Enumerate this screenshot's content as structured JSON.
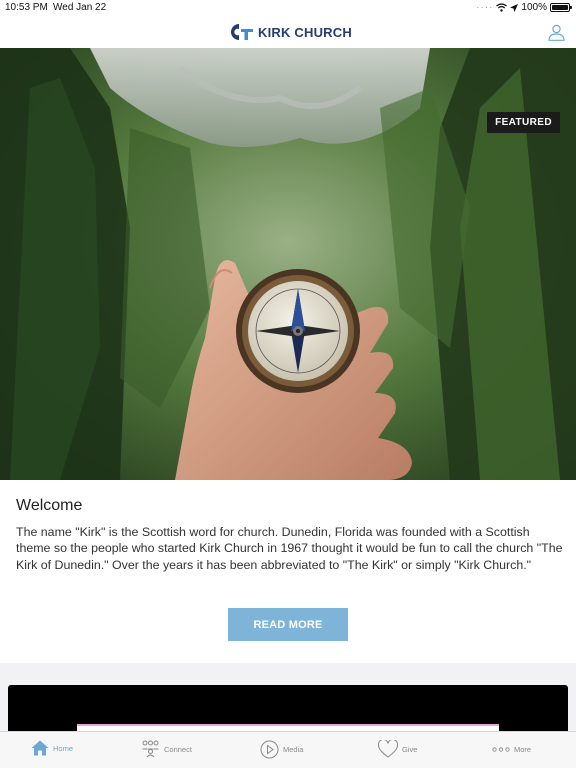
{
  "status_bar": {
    "time": "10:53 PM",
    "date": "Wed Jan 22",
    "battery": "100%"
  },
  "header": {
    "logo_text": "KIRK CHURCH"
  },
  "hero": {
    "badge": "FEATURED"
  },
  "article": {
    "title": "Welcome",
    "body": "The name \"Kirk\" is the Scottish word for church. Dunedin, Florida was founded with a Scottish theme so the people who started Kirk Church in 1967 thought it would be fun to call the church \"The Kirk of Dunedin.\" Over the years it has been abbreviated to \"The Kirk\" or simply \"Kirk Church.\"",
    "button_label": "READ MORE"
  },
  "tabs": [
    {
      "label": "Home",
      "icon": "home-icon"
    },
    {
      "label": "Connect",
      "icon": "people-icon"
    },
    {
      "label": "Media",
      "icon": "play-icon"
    },
    {
      "label": "Give",
      "icon": "heart-icon"
    },
    {
      "label": "More",
      "icon": "ellipsis-icon"
    }
  ],
  "colors": {
    "brand": "#243d73",
    "accent": "#6da7d3",
    "button": "#7eb4d8"
  }
}
